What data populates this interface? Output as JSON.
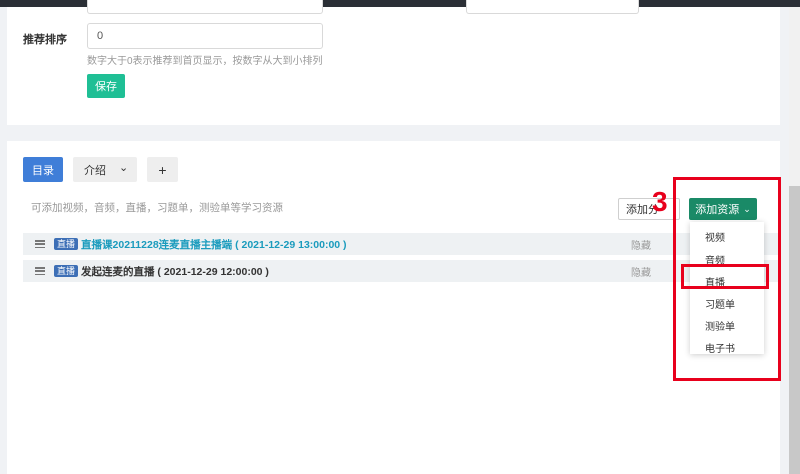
{
  "form": {
    "sort_label": "推荐排序",
    "sort_value": "0",
    "sort_hint": "数字大于0表示推荐到首页显示，按数字从大到小排列",
    "save_label": "保存"
  },
  "tabs": {
    "catalog": "目录",
    "intro": "介绍",
    "intro_caret": "⌄",
    "add": "+"
  },
  "catalog": {
    "hint": "可添加视频，音频，直播，习题单，测验单等学习资源",
    "add_group": "添加分",
    "add_resource": "添加资源",
    "add_resource_caret": "⌄"
  },
  "rows": [
    {
      "tag": "直播",
      "title": "直播课20211228连麦直播主播端 ( 2021-12-29 13:00:00 )",
      "status": "隐藏"
    },
    {
      "tag": "直播",
      "title": "发起连麦的直播 ( 2021-12-29 12:00:00 )",
      "status": "隐藏"
    }
  ],
  "dropdown": {
    "items": [
      "视频",
      "音频",
      "直播",
      "习题单",
      "测验单",
      "电子书"
    ]
  },
  "annotation": {
    "step": "3",
    "color": "#e8001c"
  }
}
